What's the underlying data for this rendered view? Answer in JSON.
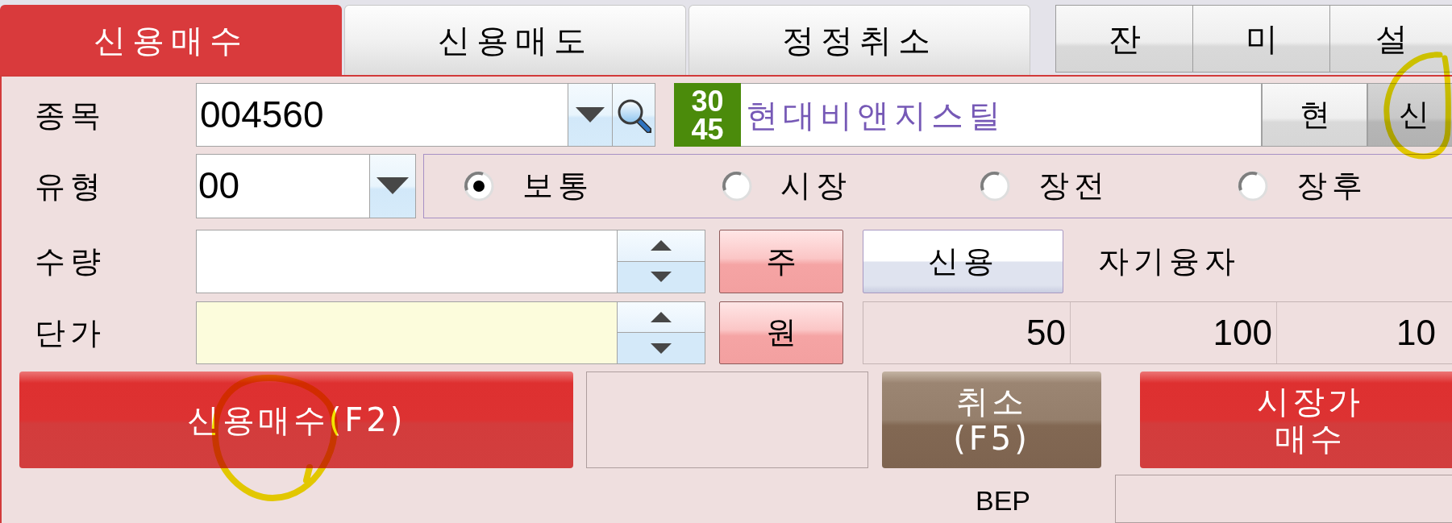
{
  "tabs": [
    {
      "label": "신용매수",
      "selected": true
    },
    {
      "label": "신용매도",
      "selected": false
    },
    {
      "label": "정정취소",
      "selected": false
    }
  ],
  "side_buttons": [
    {
      "label": "잔"
    },
    {
      "label": "미"
    },
    {
      "label": "설"
    }
  ],
  "stock": {
    "label": "종목",
    "code": "004560",
    "badge": [
      "30",
      "45"
    ],
    "name": "현대비앤지스틸",
    "price_modes": [
      {
        "label": "현",
        "selected": false
      },
      {
        "label": "신",
        "selected": true
      }
    ]
  },
  "order_type": {
    "label": "유형",
    "code": "00",
    "options": [
      {
        "label": "보통",
        "selected": true
      },
      {
        "label": "시장",
        "selected": false
      },
      {
        "label": "장전",
        "selected": false
      },
      {
        "label": "장후",
        "selected": false
      }
    ]
  },
  "quantity": {
    "label": "수량",
    "unit": "주",
    "credit_button": "신용",
    "credit_kind": "자기융자"
  },
  "price": {
    "label": "단가",
    "unit": "원",
    "ticks": [
      "50",
      "100",
      "10"
    ]
  },
  "actions": [
    {
      "kind": "buy",
      "lines": [
        "신용매수(F2)"
      ]
    },
    {
      "kind": "blank"
    },
    {
      "kind": "cancel",
      "lines": [
        "취소",
        "(F5)"
      ]
    },
    {
      "kind": "buy",
      "lines": [
        "시장가",
        "매수"
      ]
    }
  ],
  "bep": {
    "label": "BEP"
  }
}
